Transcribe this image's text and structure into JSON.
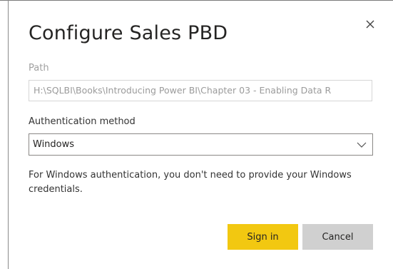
{
  "dialog": {
    "title": "Configure Sales PBD",
    "close_icon": "close-icon",
    "path": {
      "label": "Path",
      "value": "H:\\SQLBI\\Books\\Introducing Power BI\\Chapter 03 - Enabling Data R"
    },
    "auth": {
      "label": "Authentication method",
      "selected": "Windows",
      "icon": "chevron-down-icon"
    },
    "info_text": "For Windows authentication, you don't need to provide your Windows credentials.",
    "buttons": {
      "sign_in": "Sign in",
      "cancel": "Cancel"
    },
    "colors": {
      "primary_button": "#f2c811",
      "secondary_button": "#d0d0d0"
    }
  }
}
